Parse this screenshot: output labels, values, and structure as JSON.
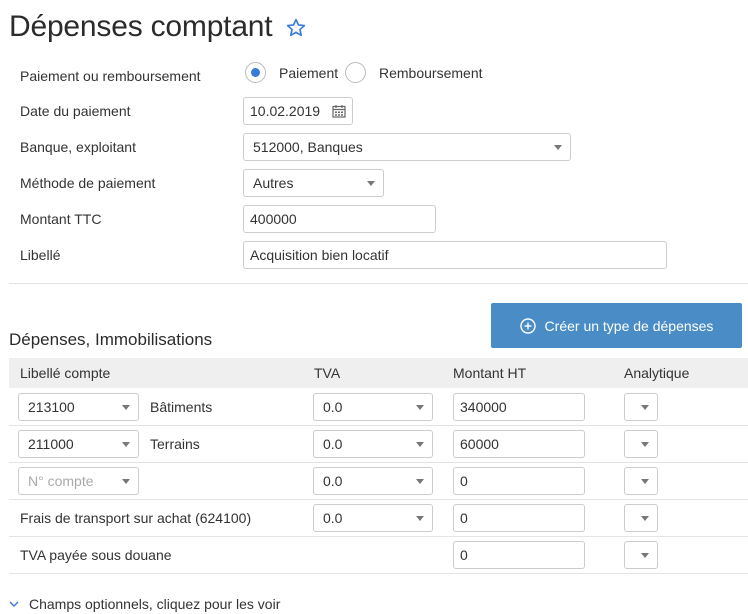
{
  "page": {
    "title": "Dépenses comptant"
  },
  "form": {
    "payment_type": {
      "label": "Paiement ou remboursement",
      "options": [
        "Paiement",
        "Remboursement"
      ],
      "selected": "Paiement"
    },
    "date": {
      "label": "Date du paiement",
      "value": "10.02.2019"
    },
    "bank": {
      "label": "Banque, exploitant",
      "value": "512000, Banques"
    },
    "method": {
      "label": "Méthode de paiement",
      "value": "Autres"
    },
    "amount": {
      "label": "Montant TTC",
      "value": "400000"
    },
    "description": {
      "label": "Libellé",
      "value": "Acquisition bien locatif"
    }
  },
  "expenses": {
    "title": "Dépenses, Immobilisations",
    "create_button": "Créer un type de dépenses",
    "columns": [
      "Libellé compte",
      "TVA",
      "Montant HT",
      "Analytique"
    ],
    "rows": [
      {
        "account": "213100",
        "account_name": "Bâtiments",
        "tva": "0.0",
        "amount": "340000",
        "analytic": ""
      },
      {
        "account": "211000",
        "account_name": "Terrains",
        "tva": "0.0",
        "amount": "60000",
        "analytic": ""
      },
      {
        "account_placeholder": "N° compte",
        "tva": "0.0",
        "amount": "0",
        "analytic": ""
      },
      {
        "label": "Frais de transport sur achat (624100)",
        "tva": "0.0",
        "amount": "0",
        "analytic": ""
      },
      {
        "label": "TVA payée sous douane",
        "amount": "0",
        "analytic": ""
      }
    ]
  },
  "optional_fields": "Champs optionnels, cliquez pour les voir",
  "colors": {
    "accent": "#4a8cc5",
    "radio": "#3a7bd5",
    "star": "#3a7bd5"
  }
}
